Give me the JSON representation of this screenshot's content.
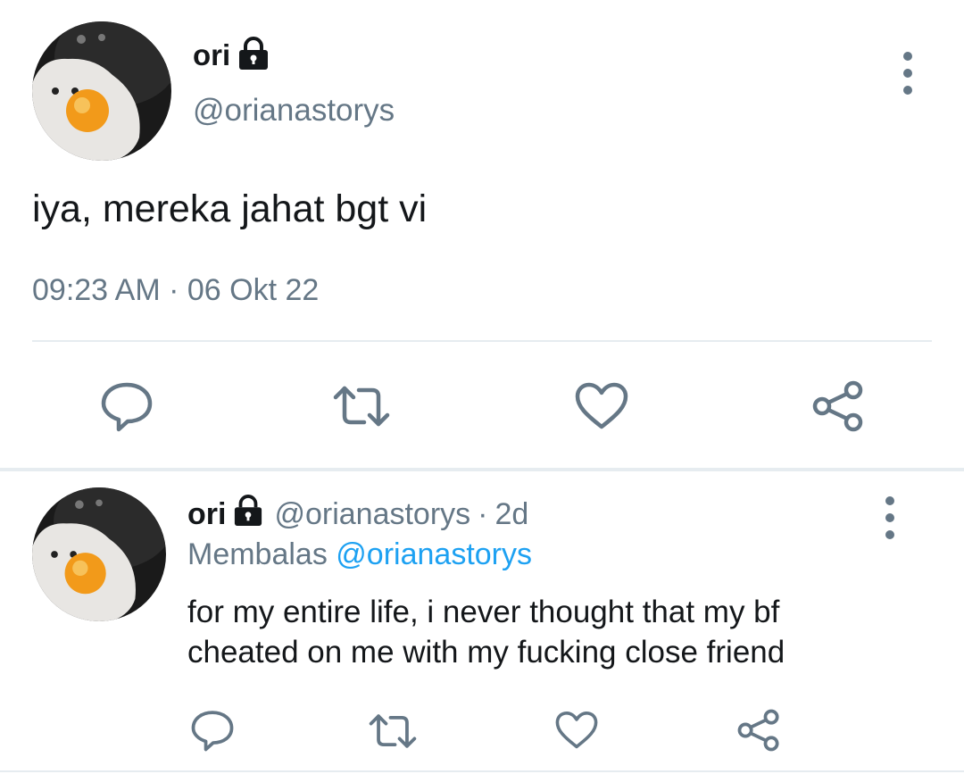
{
  "main_tweet": {
    "display_name": "ori",
    "handle": "@orianastorys",
    "text": "iya, mereka jahat bgt vi",
    "timestamp": "09:23 AM · 06 Okt 22",
    "actions": [
      "reply-icon",
      "retweet-icon",
      "like-icon",
      "share-icon"
    ]
  },
  "reply_tweet": {
    "display_name": "ori",
    "handle": "@orianastorys",
    "separator": "·",
    "age": "2d",
    "replying_prefix": "Membalas",
    "replying_to": "@orianastorys",
    "text_line1": "for my entire life, i never thought that my bf",
    "text_line2": "cheated on me with my fucking close friend",
    "actions": [
      "reply-icon",
      "retweet-icon",
      "like-icon",
      "share-icon"
    ]
  },
  "colors": {
    "text": "#14171a",
    "secondary": "#657786",
    "link": "#1da1f2",
    "divider": "#e6ecf0"
  }
}
